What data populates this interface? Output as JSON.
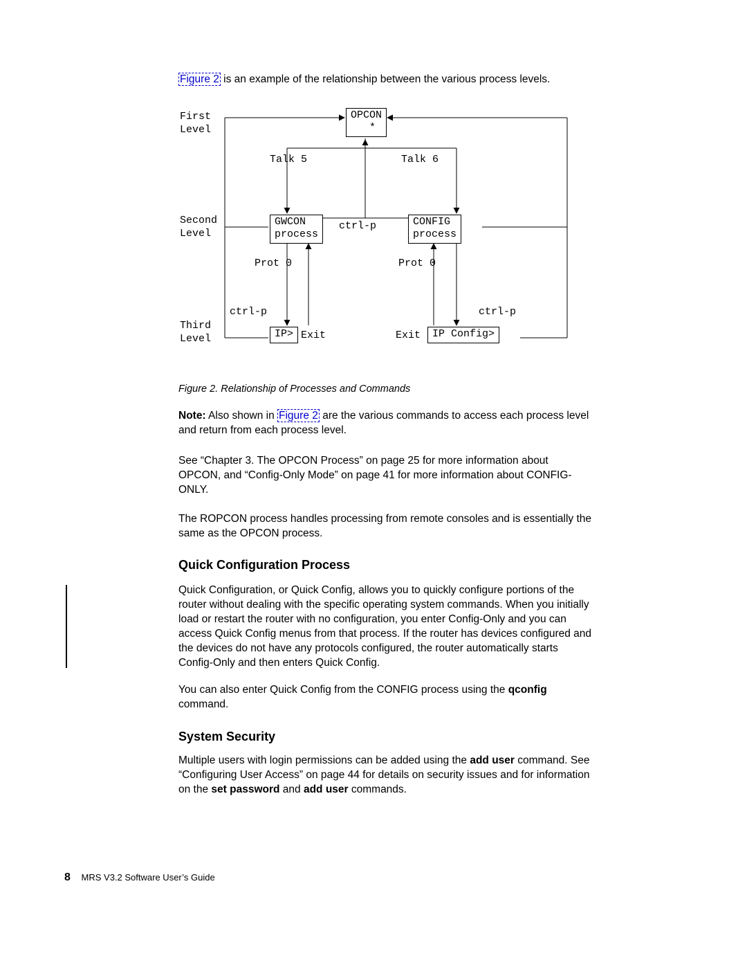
{
  "intro_prefix_link": "Figure 2",
  "intro_rest": " is an example of the relationship between the various process levels.",
  "diagram": {
    "level1": "First\nLevel",
    "level2": "Second\nLevel",
    "level3": "Third\nLevel",
    "opcon": "OPCON\n  *",
    "talk5": "Talk 5",
    "talk6": "Talk 6",
    "gwcon": "GWCON\nprocess",
    "ctrlp_mid": "ctrl-p",
    "config": "CONFIG\nprocess",
    "prot0_l": "Prot 0",
    "prot0_r": "Prot 0",
    "ctrlp_l": "ctrl-p",
    "ctrlp_r": "ctrl-p",
    "ip": "IP>",
    "exit_l": "Exit",
    "exit_r": "Exit",
    "ipcfg": "IP Config>"
  },
  "figure_caption": "Figure 2. Relationship of Processes and Commands",
  "note_label": "Note:",
  "note_before_link": " Also shown in ",
  "note_link": "Figure 2",
  "note_after_link": " are the various commands to access each process level and return from each process level.",
  "see_para": "See “Chapter 3. The OPCON Process” on page 25 for more information about OPCON, and “Config-Only Mode” on page 41 for more information about CONFIG-ONLY.",
  "ropcon_para": "The ROPCON process handles processing from remote consoles and is essentially the same as the OPCON process.",
  "quick_heading": "Quick Configuration Process",
  "quick_para1": "Quick Configuration, or Quick Config, allows you to quickly configure portions of the router without dealing with the specific operating system commands. When you initially load or restart the router with no configuration, you enter Config-Only and you can access Quick Config menus from that process. If the router has devices configured and the devices do not have any protocols configured, the router automatically starts Config-Only and then enters Quick Config.",
  "quick_para2_a": "You can also enter Quick Config from the CONFIG process using the ",
  "quick_para2_cmd": "qconfig",
  "quick_para2_b": " command.",
  "sec_heading": "System Security",
  "sec_para_a": "Multiple users with login permissions can be added using the ",
  "sec_cmd1": "add user",
  "sec_para_b": " command. See “Configuring User Access” on page 44 for details on security issues and for information on the ",
  "sec_cmd2": "set password",
  "sec_para_c": " and ",
  "sec_cmd3": "add user",
  "sec_para_d": " commands.",
  "footer_page": "8",
  "footer_title": "MRS V3.2 Software User’s Guide"
}
